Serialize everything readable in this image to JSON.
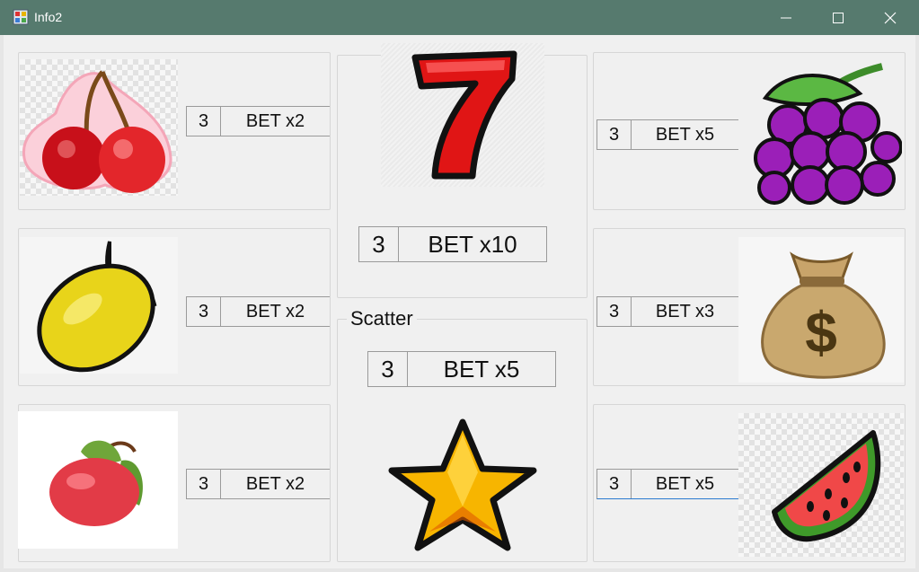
{
  "window": {
    "title": "Info2",
    "controls": [
      "minimize",
      "maximize",
      "close"
    ],
    "app_icon": "app-icon"
  },
  "scatter_group": {
    "label": "Scatter"
  },
  "symbols": {
    "cherry": {
      "icon": "cherry-icon",
      "count": "3",
      "bet": "BET x2"
    },
    "lemon": {
      "icon": "lemon-icon",
      "count": "3",
      "bet": "BET x2"
    },
    "apple": {
      "icon": "apple-icon",
      "count": "3",
      "bet": "BET x2"
    },
    "seven": {
      "icon": "seven-icon",
      "count": "3",
      "bet": "BET x10"
    },
    "star": {
      "icon": "star-icon",
      "count": "3",
      "bet": "BET x5"
    },
    "grapes": {
      "icon": "grapes-icon",
      "count": "3",
      "bet": "BET x5"
    },
    "money_bag": {
      "icon": "money-bag-icon",
      "count": "3",
      "bet": "BET x3"
    },
    "watermelon": {
      "icon": "watermelon-icon",
      "count": "3",
      "bet": "BET x5"
    }
  },
  "colors": {
    "titlebar": "#567a6e",
    "window_bg": "#f0f0f0",
    "focus_accent": "#2b7bd0"
  }
}
